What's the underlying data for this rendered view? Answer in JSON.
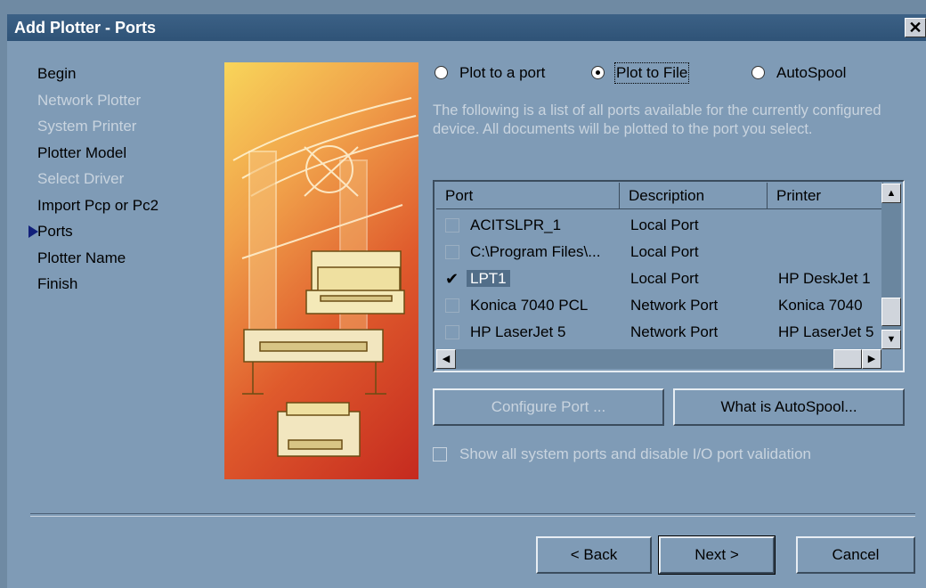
{
  "window": {
    "title": "Add Plotter - Ports",
    "close_glyph": "✕"
  },
  "steps": [
    {
      "label": "Begin",
      "enabled": true
    },
    {
      "label": "Network Plotter",
      "enabled": false
    },
    {
      "label": "System Printer",
      "enabled": false
    },
    {
      "label": "Plotter Model",
      "enabled": true
    },
    {
      "label": "Select Driver",
      "enabled": false
    },
    {
      "label": "Import Pcp or Pc2",
      "enabled": true
    },
    {
      "label": "Ports",
      "enabled": true,
      "current": true
    },
    {
      "label": "Plotter Name",
      "enabled": true
    },
    {
      "label": "Finish",
      "enabled": true
    }
  ],
  "options": {
    "plot_to_port": {
      "label": "Plot to a port",
      "checked": false
    },
    "plot_to_file": {
      "label": "Plot to File",
      "checked": true
    },
    "autospool": {
      "label": "AutoSpool",
      "checked": false
    }
  },
  "description": "The following is a list of all ports available for the currently configured device. All documents will be plotted to the port you select.",
  "ports_table": {
    "columns": [
      "Port",
      "Description",
      "Printer"
    ],
    "rows": [
      {
        "checked": false,
        "port": "ACITSLPR_1",
        "description": "Local Port",
        "printer": ""
      },
      {
        "checked": false,
        "port": "C:\\Program Files\\...",
        "description": "Local Port",
        "printer": ""
      },
      {
        "checked": true,
        "port": "LPT1",
        "description": "Local Port",
        "printer": "HP DeskJet 1"
      },
      {
        "checked": false,
        "port": "Konica 7040 PCL",
        "description": "Network Port",
        "printer": "Konica 7040"
      },
      {
        "checked": false,
        "port": "HP LaserJet 5",
        "description": "Network Port",
        "printer": "HP LaserJet 5"
      }
    ]
  },
  "buttons": {
    "configure_port": "Configure Port ...",
    "what_is_autospool": "What is AutoSpool...",
    "back": "< Back",
    "next": "Next >",
    "cancel": "Cancel"
  },
  "show_all_ports": {
    "label": "Show all system ports and disable I/O port validation",
    "checked": false,
    "enabled": false
  },
  "icons": [
    "close-icon",
    "step-arrow-icon",
    "plotter-illustration",
    "scroll-up-icon",
    "scroll-down-icon",
    "scroll-left-icon",
    "scroll-right-icon",
    "checkmark-icon"
  ]
}
